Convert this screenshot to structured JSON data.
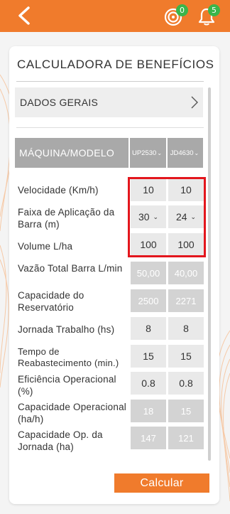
{
  "header": {
    "target_badge": "0",
    "bell_badge": "5"
  },
  "card": {
    "title": "CALCULADORA DE BENEFÍCIOS",
    "general_section": "DADOS GERAIS",
    "machine_header": "MÁQUINA/MODELO",
    "models": [
      "UP2530",
      "JD4630"
    ],
    "rows": [
      {
        "label": "Velocidade (Km/h)",
        "values": [
          "10",
          "10"
        ]
      },
      {
        "label": "Faixa de Aplicação da Barra (m)",
        "values": [
          "30",
          "24"
        ]
      },
      {
        "label": "Volume L/ha",
        "values": [
          "100",
          "100"
        ]
      },
      {
        "label": "Vazão Total Barra L/min",
        "values": [
          "50,00",
          "40,00"
        ]
      },
      {
        "label": "Capacidade do Reservatório",
        "values": [
          "2500",
          "2271"
        ]
      },
      {
        "label": "Jornada Trabalho (hs)",
        "values": [
          "8",
          "8"
        ]
      },
      {
        "label": "Tempo de Reabastecimento (min.)",
        "values": [
          "15",
          "15"
        ]
      },
      {
        "label": "Eficiência Operacional (%)",
        "values": [
          "0.8",
          "0.8"
        ]
      },
      {
        "label": "Capacidade Operacional (ha/h)",
        "values": [
          "18",
          "15"
        ]
      },
      {
        "label": "Capacidade Op. da Jornada (ha)",
        "values": [
          "147",
          "121"
        ]
      }
    ],
    "calculate_label": "Calcular"
  },
  "colors": {
    "accent": "#f07b2c",
    "badge": "#3bb54a",
    "highlight": "#e3161d"
  }
}
